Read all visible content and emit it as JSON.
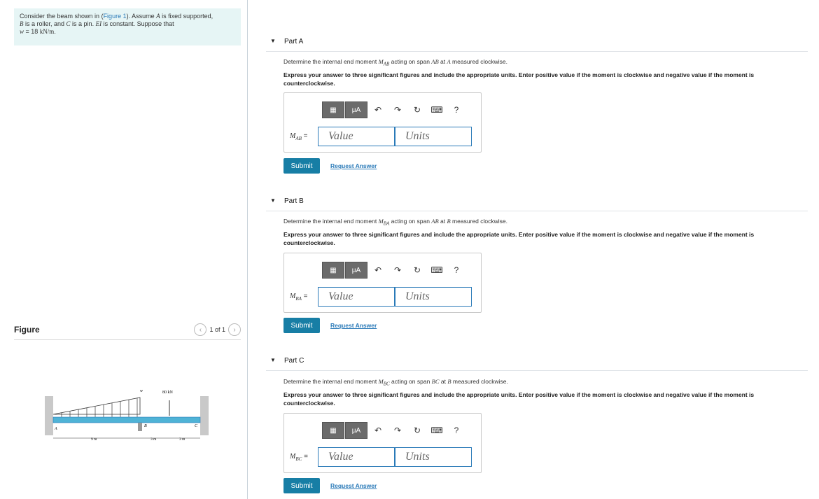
{
  "problem": {
    "line1_a": "Consider the beam shown in (",
    "line1_link": "Figure 1",
    "line1_b": "). Assume ",
    "line1_A": "A",
    "line1_c": " is fixed supported,",
    "line2_B": "B",
    "line2_a": " is a roller, and ",
    "line2_C": "C",
    "line2_b": " is a pin. ",
    "line2_EI": "EI",
    "line2_c": " is constant. Suppose that",
    "line3_w": "w",
    "line3_eq": " = 18 ",
    "line3_unit": "kN/m",
    "line3_end": "."
  },
  "figure": {
    "label": "Figure",
    "pager": "1 of 1",
    "load_w": "w",
    "load_p": "80 kN",
    "pt_A": "A",
    "pt_B": "B",
    "pt_C": "C",
    "dim1": "9 m",
    "dim2": "3 m",
    "dim3": "3 m"
  },
  "parts": [
    {
      "title": "Part A",
      "prompt_a": "Determine the internal end moment ",
      "prompt_sym": "M",
      "prompt_sub": "AB",
      "prompt_b": " acting on span ",
      "prompt_span": "AB",
      "prompt_c": " at ",
      "prompt_pt": "A",
      "prompt_d": " measured clockwise.",
      "instructions": "Express your answer to three significant figures and include the appropriate units. Enter positive value if the moment is clockwise and negative value if the moment is counterclockwise.",
      "label_sym": "M",
      "label_sub": "AB",
      "label_eq": " =",
      "value_placeholder": "Value",
      "units_placeholder": "Units",
      "submit": "Submit",
      "request": "Request Answer"
    },
    {
      "title": "Part B",
      "prompt_a": "Determine the internal end moment ",
      "prompt_sym": "M",
      "prompt_sub": "BA",
      "prompt_b": " acting on span ",
      "prompt_span": "AB",
      "prompt_c": " at ",
      "prompt_pt": "B",
      "prompt_d": " measured clockwise.",
      "instructions": "Express your answer to three significant figures and include the appropriate units. Enter positive value if the moment is clockwise and negative value if the moment is counterclockwise.",
      "label_sym": "M",
      "label_sub": "BA",
      "label_eq": " =",
      "value_placeholder": "Value",
      "units_placeholder": "Units",
      "submit": "Submit",
      "request": "Request Answer"
    },
    {
      "title": "Part C",
      "prompt_a": "Determine the internal end moment ",
      "prompt_sym": "M",
      "prompt_sub": "BC",
      "prompt_b": " acting on span ",
      "prompt_span": "BC",
      "prompt_c": " at ",
      "prompt_pt": "B",
      "prompt_d": " measured clockwise.",
      "instructions": "Express your answer to three significant figures and include the appropriate units. Enter positive value if the moment is clockwise and negative value if the moment is counterclockwise.",
      "label_sym": "M",
      "label_sub": "BC",
      "label_eq": " =",
      "value_placeholder": "Value",
      "units_placeholder": "Units",
      "submit": "Submit",
      "request": "Request Answer"
    }
  ],
  "toolbar": {
    "templates_icon": "templates-icon",
    "units_label": "μA",
    "undo_icon": "undo-icon",
    "redo_icon": "redo-icon",
    "reset_icon": "reset-icon",
    "keyboard_icon": "keyboard-icon",
    "help_label": "?"
  },
  "colors": {
    "accent": "#177ea5",
    "link": "#2a7ab8",
    "problem_bg": "#e6f5f5",
    "beam": "#4fb3d6"
  }
}
